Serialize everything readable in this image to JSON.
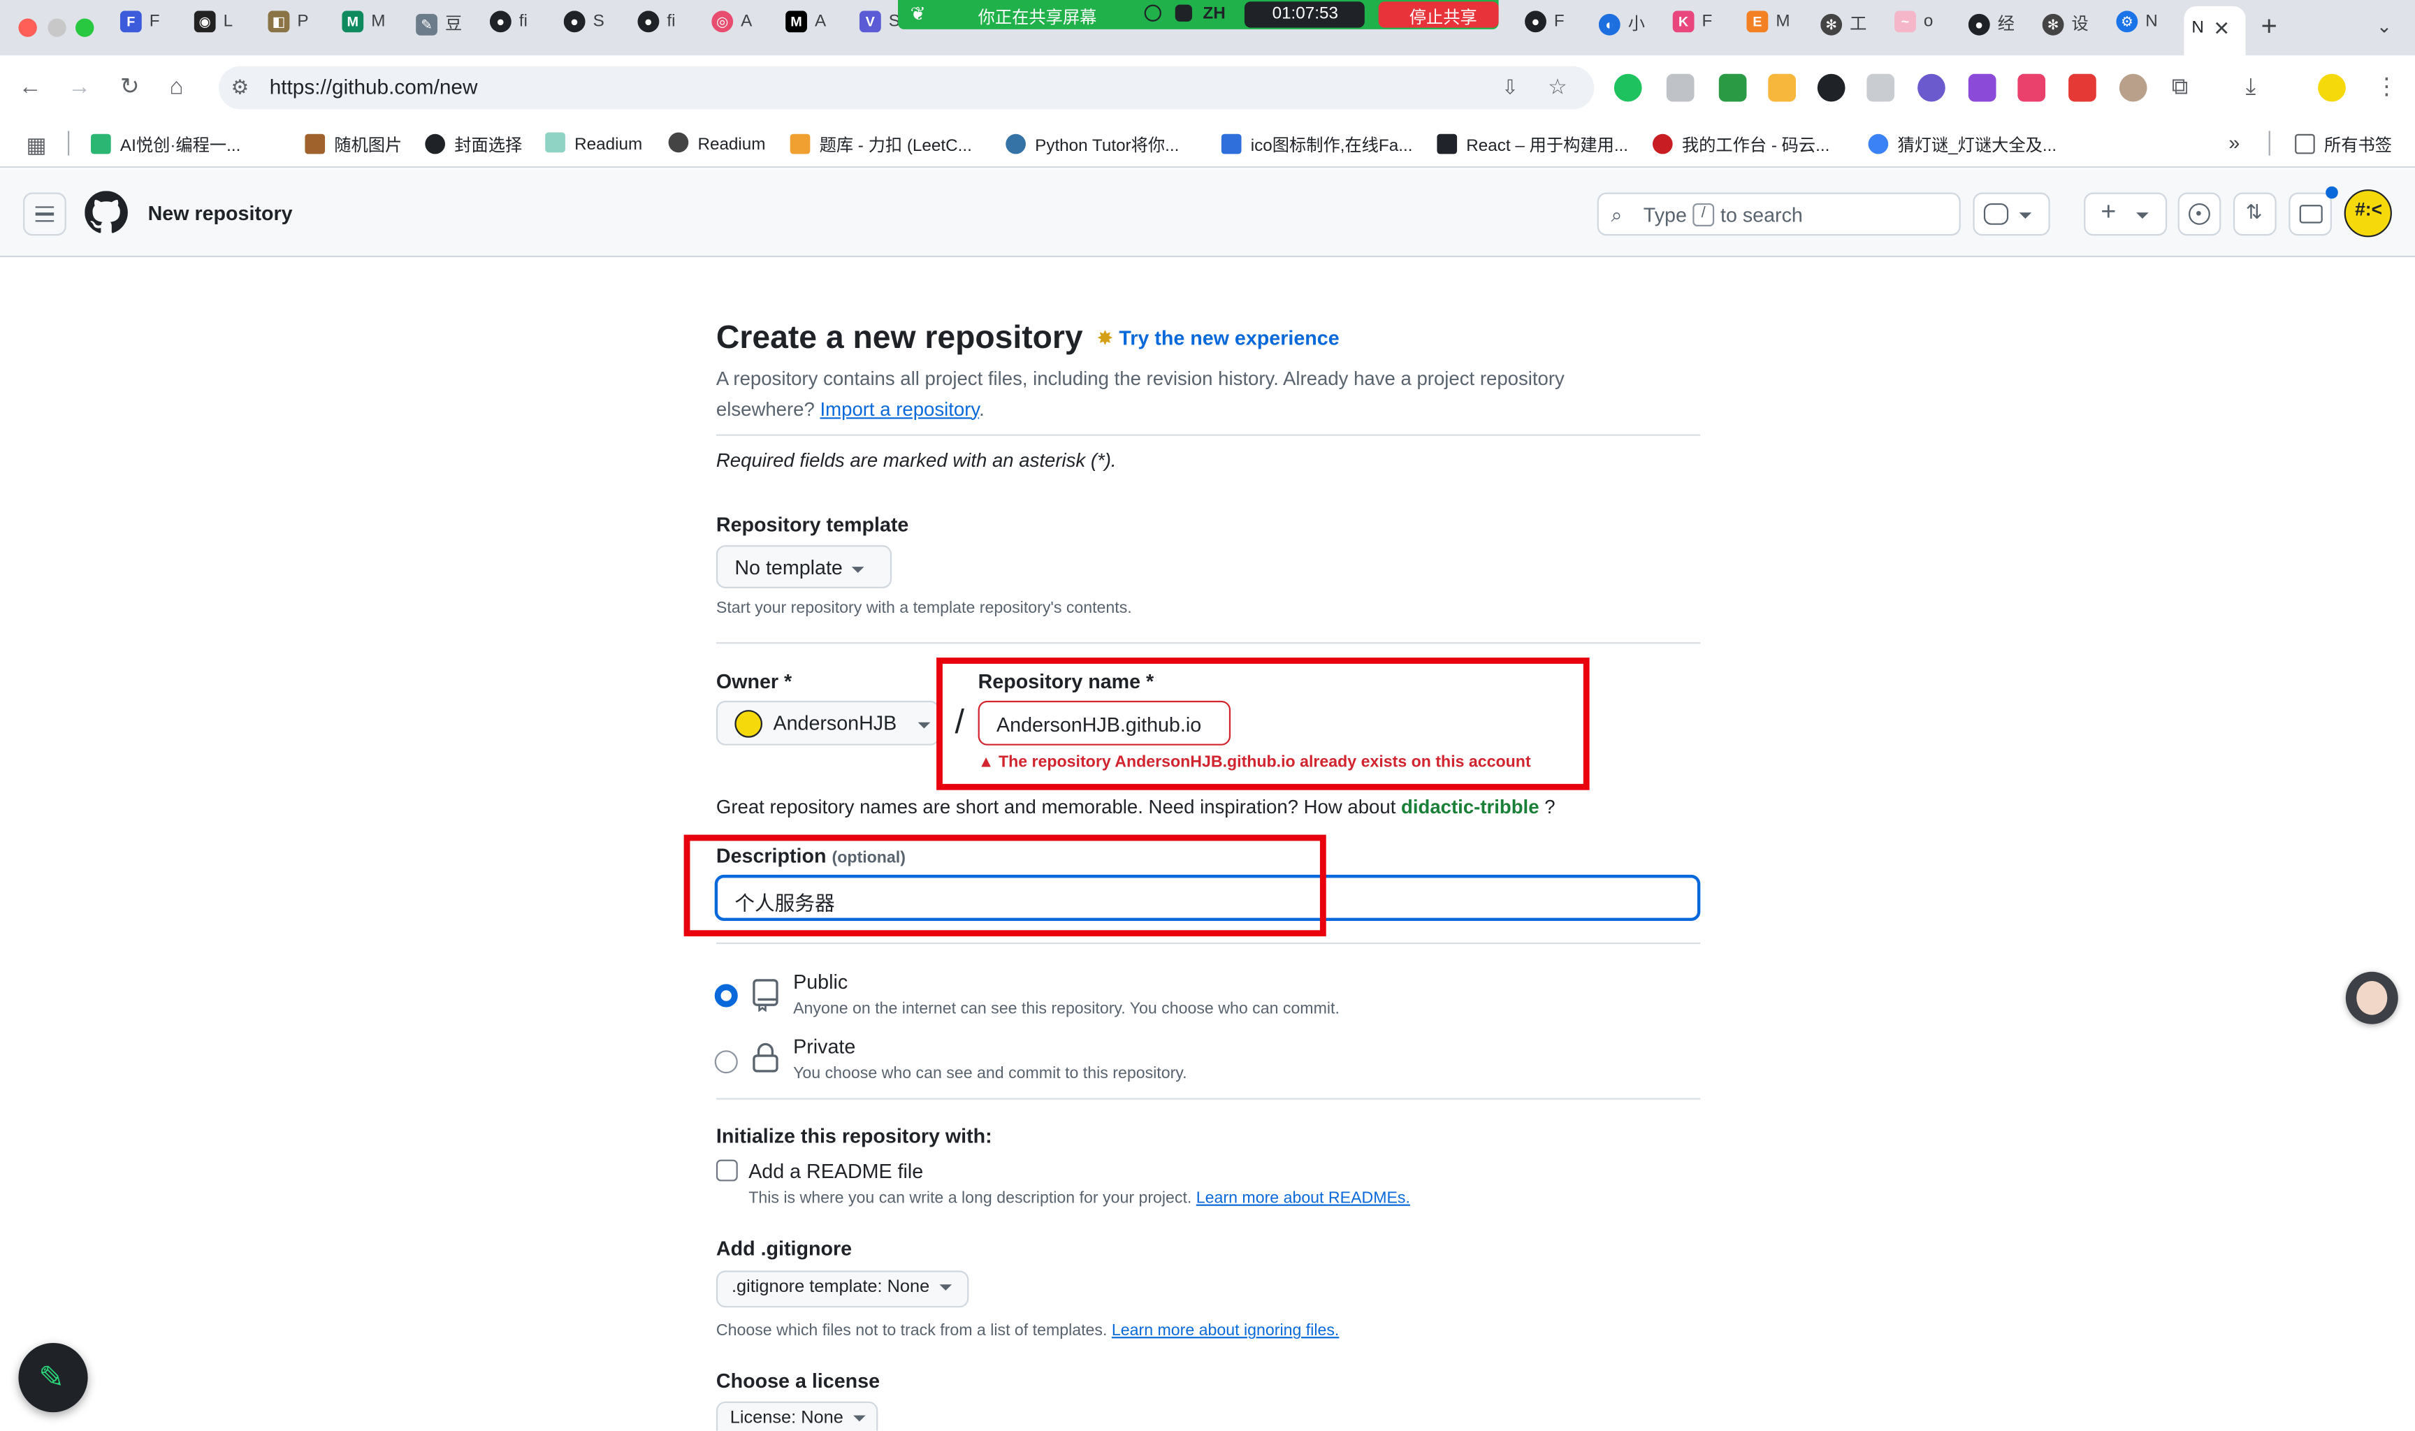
{
  "browser": {
    "tabs": [
      "F",
      "L",
      "P",
      "M",
      "豆",
      "fi",
      "S",
      "fi",
      "A",
      "A",
      "S",
      "F",
      "小",
      "F",
      "M",
      "工",
      "o",
      "经",
      "设",
      "N"
    ],
    "share_bar": {
      "text": "你正在共享屏幕",
      "lang": "ZH",
      "timer": "01:07:53",
      "stop_label": "停止共享"
    },
    "url": "https://github.com/new",
    "bookmarks": [
      "AI悦创·编程一...",
      "随机图片",
      "封面选择",
      "Readium",
      "Readium",
      "题库 - 力扣 (LeetC...",
      "Python Tutor将你...",
      "ico图标制作,在线Fa...",
      "React – 用于构建用...",
      "我的工作台 - 码云...",
      "猜灯谜_灯谜大全及..."
    ],
    "all_bookmarks": "所有书签"
  },
  "header": {
    "title": "New repository",
    "search_prefix": "Type",
    "search_key": "/",
    "search_suffix": "to search"
  },
  "form": {
    "title": "Create a new repository",
    "try_new": "Try the new experience",
    "intro": "A repository contains all project files, including the revision history. Already have a project repository elsewhere?",
    "import_link": "Import a repository",
    "required_note": "Required fields are marked with an asterisk (*).",
    "template_label": "Repository template",
    "template_value": "No template",
    "template_help": "Start your repository with a template repository's contents.",
    "owner_label": "Owner *",
    "owner_value": "AndersonHJB",
    "slash": "/",
    "repo_name_label": "Repository name *",
    "repo_name_value": "AndersonHJB.github.io",
    "repo_error": "The repository AndersonHJB.github.io already exists on this account",
    "inspiration_text": "Great repository names are short and memorable. Need inspiration? How about",
    "inspiration_name": "didactic-tribble",
    "inspiration_end": "?",
    "description_label": "Description",
    "description_optional": "(optional)",
    "description_value": "个人服务器",
    "public_label": "Public",
    "public_desc": "Anyone on the internet can see this repository. You choose who can commit.",
    "private_label": "Private",
    "private_desc": "You choose who can see and commit to this repository.",
    "init_label": "Initialize this repository with:",
    "readme_label": "Add a README file",
    "readme_desc": "This is where you can write a long description for your project.",
    "readme_link": "Learn more about READMEs.",
    "gitignore_label": "Add .gitignore",
    "gitignore_value": ".gitignore template: None",
    "gitignore_desc": "Choose which files not to track from a list of templates.",
    "gitignore_link": "Learn more about ignoring files.",
    "license_label": "Choose a license",
    "license_value": "License: None"
  },
  "colors": {
    "accent": "#0969da",
    "danger": "#d1242f",
    "highlight": "#e8000c",
    "share_green": "#20b14a"
  }
}
